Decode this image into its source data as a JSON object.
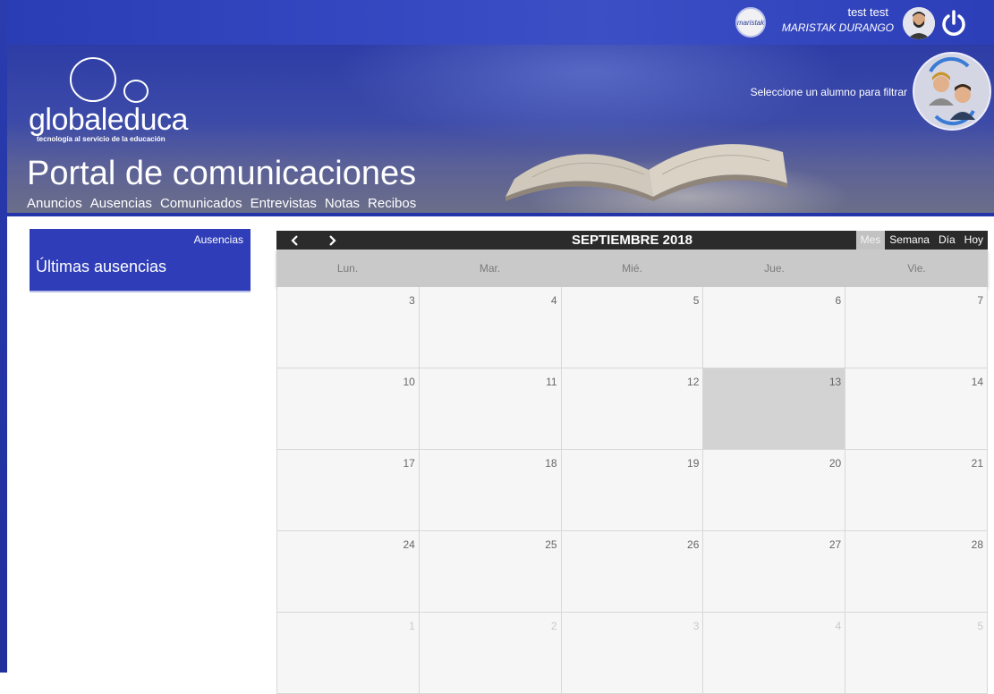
{
  "header": {
    "school_logo_text": "maristak",
    "user_name": "test test",
    "user_school": "MARISTAK DURANGO"
  },
  "banner": {
    "brand_name": "globaleduca",
    "brand_tagline": "tecnología al servicio de la educación",
    "portal_title": "Portal de comunicaciones",
    "filter_label": "Seleccione un alumno para filtrar"
  },
  "nav": {
    "items": [
      "Anuncios",
      "Ausencias",
      "Comunicados",
      "Entrevistas",
      "Notas",
      "Recibos"
    ]
  },
  "side": {
    "tag": "Ausencias",
    "title": "Últimas ausencias"
  },
  "calendar": {
    "month_title": "SEPTIEMBRE 2018",
    "views": [
      "Mes",
      "Semana",
      "Día",
      "Hoy"
    ],
    "active_view": "Mes",
    "weekdays": [
      "Lun.",
      "Mar.",
      "Mié.",
      "Jue.",
      "Vie."
    ],
    "weeks": [
      [
        "3",
        "4",
        "5",
        "6",
        "7"
      ],
      [
        "10",
        "11",
        "12",
        "13",
        "14"
      ],
      [
        "17",
        "18",
        "19",
        "20",
        "21"
      ],
      [
        "24",
        "25",
        "26",
        "27",
        "28"
      ],
      [
        "1",
        "2",
        "3",
        "4",
        "5"
      ]
    ],
    "today": "13"
  },
  "colors": {
    "primary": "#2f3db8",
    "calendar_bar": "#2b2b2b",
    "today_cell": "#d3d3d3"
  }
}
